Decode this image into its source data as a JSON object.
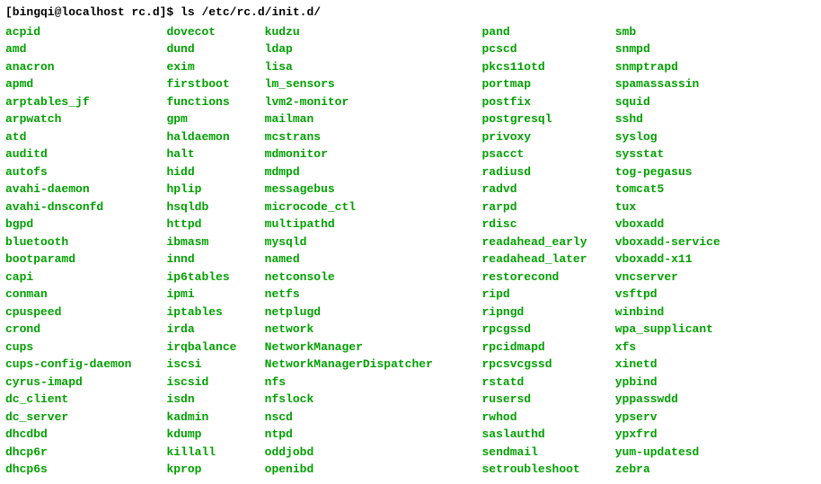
{
  "prompt": {
    "user_host": "[bingqi@localhost rc.d]$ ",
    "command": "ls /etc/rc.d/init.d/"
  },
  "columns": [
    {
      "width": 23,
      "items": [
        "acpid",
        "amd",
        "anacron",
        "apmd",
        "arptables_jf",
        "arpwatch",
        "atd",
        "auditd",
        "autofs",
        "avahi-daemon",
        "avahi-dnsconfd",
        "bgpd",
        "bluetooth",
        "bootparamd",
        "capi",
        "conman",
        "cpuspeed",
        "crond",
        "cups",
        "cups-config-daemon",
        "cyrus-imapd",
        "dc_client",
        "dc_server",
        "dhcdbd",
        "dhcp6r",
        "dhcp6s"
      ]
    },
    {
      "width": 14,
      "items": [
        "dovecot",
        "dund",
        "exim",
        "firstboot",
        "functions",
        "gpm",
        "haldaemon",
        "halt",
        "hidd",
        "hplip",
        "hsqldb",
        "httpd",
        "ibmasm",
        "innd",
        "ip6tables",
        "ipmi",
        "iptables",
        "irda",
        "irqbalance",
        "iscsi",
        "iscsid",
        "isdn",
        "kadmin",
        "kdump",
        "killall",
        "kprop"
      ]
    },
    {
      "width": 31,
      "items": [
        "kudzu",
        "ldap",
        "lisa",
        "lm_sensors",
        "lvm2-monitor",
        "mailman",
        "mcstrans",
        "mdmonitor",
        "mdmpd",
        "messagebus",
        "microcode_ctl",
        "multipathd",
        "mysqld",
        "named",
        "netconsole",
        "netfs",
        "netplugd",
        "network",
        "NetworkManager",
        "NetworkManagerDispatcher",
        "nfs",
        "nfslock",
        "nscd",
        "ntpd",
        "oddjobd",
        "openibd"
      ]
    },
    {
      "width": 19,
      "items": [
        "pand",
        "pcscd",
        "pkcs11otd",
        "portmap",
        "postfix",
        "postgresql",
        "privoxy",
        "psacct",
        "radiusd",
        "radvd",
        "rarpd",
        "rdisc",
        "readahead_early",
        "readahead_later",
        "restorecond",
        "ripd",
        "ripngd",
        "rpcgssd",
        "rpcidmapd",
        "rpcsvcgssd",
        "rstatd",
        "rusersd",
        "rwhod",
        "saslauthd",
        "sendmail",
        "setroubleshoot"
      ]
    },
    {
      "width": 17,
      "items": [
        "smb",
        "snmpd",
        "snmptrapd",
        "spamassassin",
        "squid",
        "sshd",
        "syslog",
        "sysstat",
        "tog-pegasus",
        "tomcat5",
        "tux",
        "vboxadd",
        "vboxadd-service",
        "vboxadd-x11",
        "vncserver",
        "vsftpd",
        "winbind",
        "wpa_supplicant",
        "xfs",
        "xinetd",
        "ypbind",
        "yppasswdd",
        "ypserv",
        "ypxfrd",
        "yum-updatesd",
        "zebra"
      ]
    }
  ]
}
